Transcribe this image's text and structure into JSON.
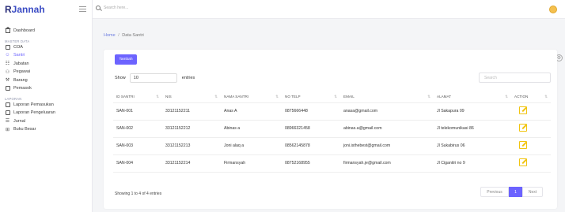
{
  "brand": {
    "logo_r": "R",
    "logo_rest": "Jannah"
  },
  "search": {
    "placeholder": "Search here..."
  },
  "sidebar": {
    "dashboard": "Dashboard",
    "master_section": "MASTER DATA",
    "master_items": [
      "COA",
      "Santri",
      "Jabatan",
      "Pegawai",
      "Barang",
      "Pemasok"
    ],
    "laporan_section": "LAPORAN",
    "laporan_items": [
      "Laporan Pemasukan",
      "Laporan Pengeluaran",
      "Jurnal",
      "Buku Besar"
    ]
  },
  "breadcrumb": {
    "home": "Home",
    "sep": "/",
    "current": "Data Santri"
  },
  "toolbar": {
    "add_label": "Tambah",
    "show_label": "Show",
    "show_value": "10",
    "entries_label": "entries",
    "search_placeholder": "Search"
  },
  "table": {
    "headers": [
      "ID SANTRI",
      "NIS",
      "NAMA SANTRI",
      "NO TELP",
      "EMAIL",
      "ALAMAT",
      "ACTION"
    ],
    "rows": [
      [
        "SAN-001",
        "33121152211",
        "Anas A",
        "0875666448",
        "anasa@gmail.com",
        "Jl Sakapura 09"
      ],
      [
        "SAN-002",
        "33121152212",
        "Abinas a",
        "08966321458",
        "abinas.a@gmail.com",
        "Jl telekomunikasi 86"
      ],
      [
        "SAN-003",
        "33121152213",
        "Joni alaq a",
        "08562145878",
        "joni.isthebest@gmail.com",
        "Jl Sukabirus 06"
      ],
      [
        "SAN-004",
        "33121152214",
        "Firmansyah",
        "08752168955",
        "firmansyah.je@gmail.com",
        "Jl Ciganitri no 9"
      ]
    ]
  },
  "footer": {
    "showing": "Showing 1 to 4 of 4 entries",
    "prev": "Previous",
    "page": "1",
    "next": "Next"
  },
  "colors": {
    "accent": "#6c63ff",
    "edit": "#f1c40f"
  }
}
